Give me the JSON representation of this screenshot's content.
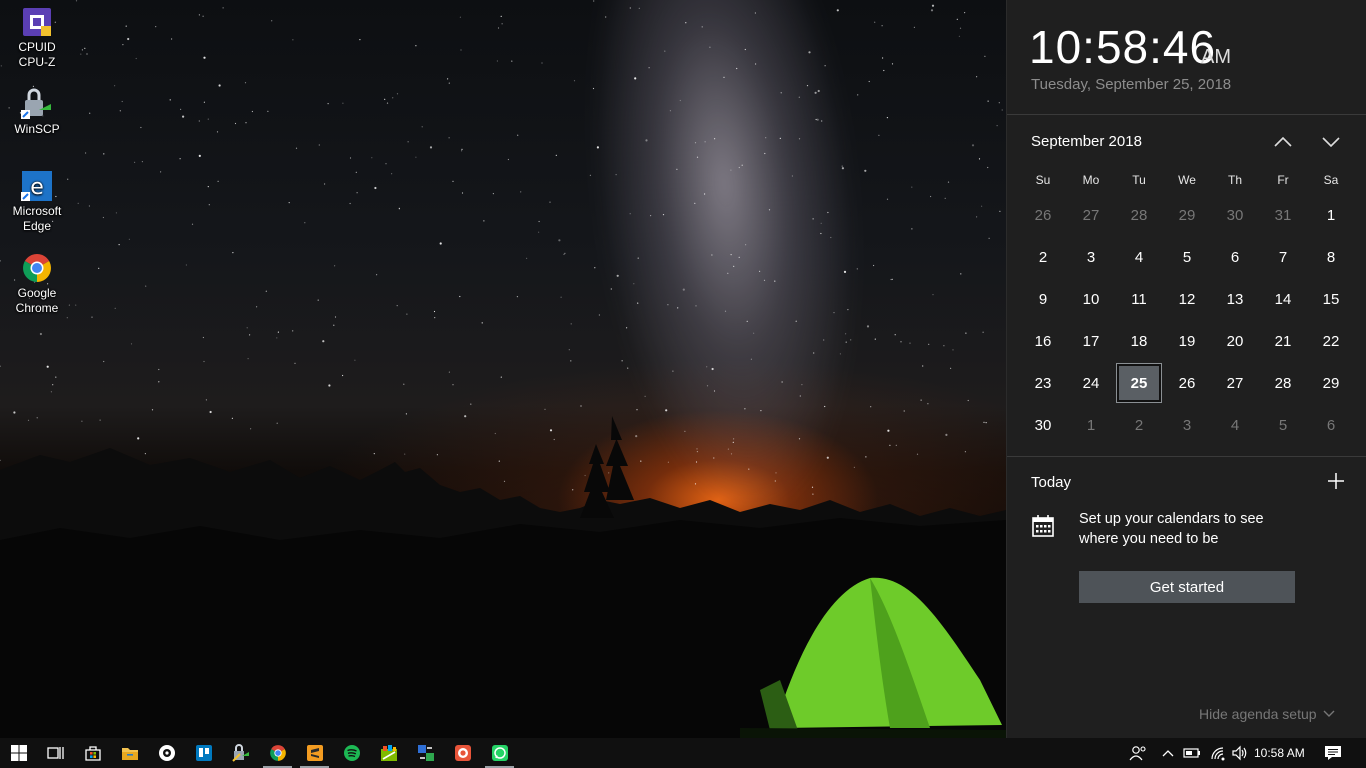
{
  "desktop": {
    "icons": [
      {
        "label_line1": "CPUID",
        "label_line2": "CPU-Z",
        "icon": "cpuz-icon"
      },
      {
        "label_line1": "WinSCP",
        "label_line2": "",
        "icon": "winscp-icon"
      },
      {
        "label_line1": "Microsoft",
        "label_line2": "Edge",
        "icon": "edge-icon"
      },
      {
        "label_line1": "Google",
        "label_line2": "Chrome",
        "icon": "chrome-icon"
      }
    ]
  },
  "flyout": {
    "time": "10:58:46",
    "ampm": "AM",
    "date": "Tuesday, September 25, 2018",
    "month_label": "September 2018",
    "weekdays": [
      "Su",
      "Mo",
      "Tu",
      "We",
      "Th",
      "Fr",
      "Sa"
    ],
    "weeks": [
      [
        "26",
        "27",
        "28",
        "29",
        "30",
        "31",
        "1"
      ],
      [
        "2",
        "3",
        "4",
        "5",
        "6",
        "7",
        "8"
      ],
      [
        "9",
        "10",
        "11",
        "12",
        "13",
        "14",
        "15"
      ],
      [
        "16",
        "17",
        "18",
        "19",
        "20",
        "21",
        "22"
      ],
      [
        "23",
        "24",
        "25",
        "26",
        "27",
        "28",
        "29"
      ],
      [
        "30",
        "1",
        "2",
        "3",
        "4",
        "5",
        "6"
      ]
    ],
    "today_value": "25",
    "agenda_title": "Today",
    "agenda_message": "Set up your calendars to see where you need to be",
    "get_started_label": "Get started",
    "hide_agenda_label": "Hide agenda setup"
  },
  "taskbar": {
    "apps": [
      "start-icon",
      "task-view-icon",
      "store-icon",
      "file-explorer-icon",
      "app-icon",
      "trello-icon",
      "winscp-icon",
      "chrome-icon",
      "sublime-text-icon",
      "spotify-icon",
      "app-icon",
      "app-icon",
      "app-icon",
      "whatsapp-icon"
    ],
    "tray_time": "10:58 AM"
  },
  "colors": {
    "flyout_bg": "#1f1f1f",
    "today_highlight": "#5a5f64",
    "button_bg": "#4e5358",
    "taskbar_bg": "#101010"
  }
}
